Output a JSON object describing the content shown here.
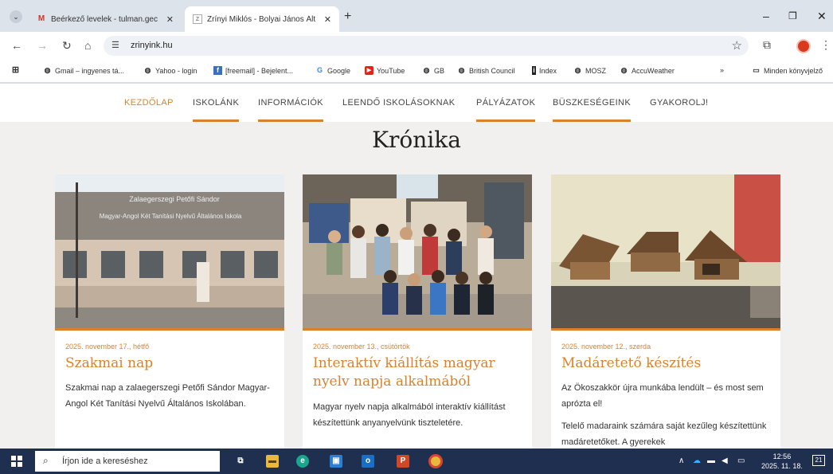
{
  "browser": {
    "tabs": [
      {
        "title": "Beérkező levelek - tulman.gec",
        "icon": "gmail-icon"
      },
      {
        "title": "Zrínyi Miklós - Bolyai János Ált",
        "icon": "school-favicon"
      }
    ],
    "url": "zrinyink.hu",
    "bookmarks": [
      {
        "label": "Gmail – ingyenes tá...",
        "icon": "globe-icon"
      },
      {
        "label": "Yahoo - login",
        "icon": "globe-icon"
      },
      {
        "label": "[freemail] - Bejelent...",
        "icon": "freemail-icon"
      },
      {
        "label": "Google",
        "icon": "google-icon"
      },
      {
        "label": "YouTube",
        "icon": "youtube-icon"
      },
      {
        "label": "GB",
        "icon": "globe-icon"
      },
      {
        "label": "British Council",
        "icon": "globe-icon"
      },
      {
        "label": "Index",
        "icon": "index-icon"
      },
      {
        "label": "MOSZ",
        "icon": "globe-icon"
      },
      {
        "label": "AccuWeather",
        "icon": "globe-icon"
      }
    ],
    "other_bookmarks": "Minden könyvjelző"
  },
  "site": {
    "nav": [
      {
        "label": "KEZDŐLAP",
        "active": true,
        "underlined": false
      },
      {
        "label": "ISKOLÁNK",
        "active": false,
        "underlined": true
      },
      {
        "label": "INFORMÁCIÓK",
        "active": false,
        "underlined": true
      },
      {
        "label": "LEENDŐ ISKOLÁSOKNAK",
        "active": false,
        "underlined": false
      },
      {
        "label": "PÁLYÁZATOK",
        "active": false,
        "underlined": true
      },
      {
        "label": "BÜSZKESÉGEINK",
        "active": false,
        "underlined": true
      },
      {
        "label": "GYAKOROLJ!",
        "active": false,
        "underlined": false
      }
    ],
    "heading": "Krónika",
    "accent_color": "#d9822b",
    "cards": [
      {
        "date": "2025. november 17., hétfő",
        "title": "Szakmai nap",
        "excerpt": [
          "Szakmai nap a zalaegerszegi Petőfi Sándor Magyar-Angol Két Tanítási Nyelvű Általános Iskolában."
        ],
        "photo_sign": [
          "Zalaegerszegi Petőfi Sándor",
          "Magyar-Angol Két Tanítási Nyelvű Általános Iskola"
        ]
      },
      {
        "date": "2025. november 13., csütörtök",
        "title": "Interaktív kiállítás magyar nyelv napja alkalmából",
        "excerpt": [
          "Magyar nyelv napja alkalmából interaktív kiállítást készítettünk anyanyelvünk tiszteletére."
        ]
      },
      {
        "date": "2025. november 12., szerda",
        "title": "Madáretető készítés",
        "excerpt": [
          "Az Ökoszakkör újra munkába lendült – és most sem aprózta el!",
          "Telelő madaraink számára saját kezűleg készítettünk madáretetőket. A gyerekek"
        ]
      }
    ]
  },
  "taskbar": {
    "search_placeholder": "Írjon ide a kereséshez",
    "time": "12:56",
    "date": "2025. 11. 18.",
    "notif_count": "21"
  }
}
